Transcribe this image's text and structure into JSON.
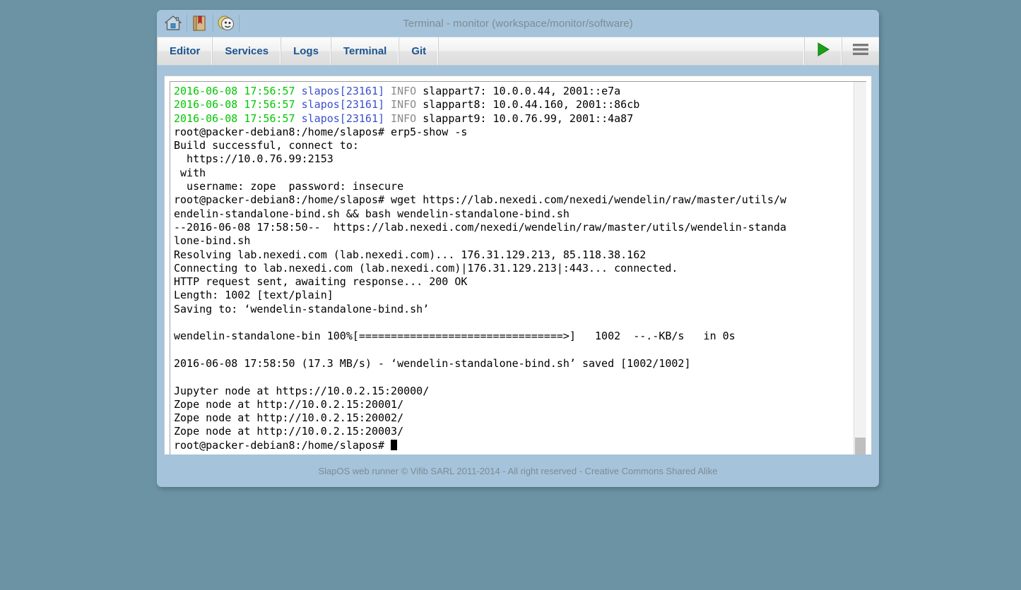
{
  "window": {
    "title": "Terminal - monitor (workspace/monitor/software)",
    "icons": [
      {
        "name": "home-icon",
        "label": "Home"
      },
      {
        "name": "book-icon",
        "label": "Documentation"
      },
      {
        "name": "mask-icon",
        "label": "Theatre"
      }
    ]
  },
  "tabs": [
    {
      "label": "Editor",
      "name": "tab-editor"
    },
    {
      "label": "Services",
      "name": "tab-services"
    },
    {
      "label": "Logs",
      "name": "tab-logs"
    },
    {
      "label": "Terminal",
      "name": "tab-terminal"
    },
    {
      "label": "Git",
      "name": "tab-git"
    }
  ],
  "toolbar": {
    "run_label": "Run",
    "menu_label": "Menu",
    "run_icon": "play-triangle-icon",
    "menu_icon": "hamburger-menu-icon",
    "accent_green": "#1a9c1a"
  },
  "colors": {
    "page_background": "#6b93a4",
    "window_background": "#a5c3da",
    "tab_text": "#1b5490",
    "log_timestamp": "#00c800",
    "log_process": "#3a50cd",
    "log_level": "#8a8a8a"
  },
  "terminal": {
    "lines": [
      {
        "segments": [
          {
            "text": "2016-06-08 17:56:57 ",
            "color": "green"
          },
          {
            "text": "slapos[23161]",
            "color": "blue"
          },
          {
            "text": " INFO",
            "color": "gray"
          },
          {
            "text": " slappart7: 10.0.0.44, 2001::e7a",
            "color": "plain"
          }
        ]
      },
      {
        "segments": [
          {
            "text": "2016-06-08 17:56:57 ",
            "color": "green"
          },
          {
            "text": "slapos[23161]",
            "color": "blue"
          },
          {
            "text": " INFO",
            "color": "gray"
          },
          {
            "text": " slappart8: 10.0.44.160, 2001::86cb",
            "color": "plain"
          }
        ]
      },
      {
        "segments": [
          {
            "text": "2016-06-08 17:56:57 ",
            "color": "green"
          },
          {
            "text": "slapos[23161]",
            "color": "blue"
          },
          {
            "text": " INFO",
            "color": "gray"
          },
          {
            "text": " slappart9: 10.0.76.99, 2001::4a87",
            "color": "plain"
          }
        ]
      },
      {
        "segments": [
          {
            "text": "root@packer-debian8:/home/slapos# erp5-show -s",
            "color": "plain"
          }
        ]
      },
      {
        "segments": [
          {
            "text": "Build successful, connect to:",
            "color": "plain"
          }
        ]
      },
      {
        "segments": [
          {
            "text": "  https://10.0.76.99:2153",
            "color": "plain"
          }
        ]
      },
      {
        "segments": [
          {
            "text": " with",
            "color": "plain"
          }
        ]
      },
      {
        "segments": [
          {
            "text": "  username: zope  password: insecure",
            "color": "plain"
          }
        ]
      },
      {
        "segments": [
          {
            "text": "root@packer-debian8:/home/slapos# wget https://lab.nexedi.com/nexedi/wendelin/raw/master/utils/w",
            "color": "plain"
          }
        ]
      },
      {
        "segments": [
          {
            "text": "endelin-standalone-bind.sh && bash wendelin-standalone-bind.sh",
            "color": "plain"
          }
        ]
      },
      {
        "segments": [
          {
            "text": "--2016-06-08 17:58:50--  https://lab.nexedi.com/nexedi/wendelin/raw/master/utils/wendelin-standa",
            "color": "plain"
          }
        ]
      },
      {
        "segments": [
          {
            "text": "lone-bind.sh",
            "color": "plain"
          }
        ]
      },
      {
        "segments": [
          {
            "text": "Resolving lab.nexedi.com (lab.nexedi.com)... 176.31.129.213, 85.118.38.162",
            "color": "plain"
          }
        ]
      },
      {
        "segments": [
          {
            "text": "Connecting to lab.nexedi.com (lab.nexedi.com)|176.31.129.213|:443... connected.",
            "color": "plain"
          }
        ]
      },
      {
        "segments": [
          {
            "text": "HTTP request sent, awaiting response... 200 OK",
            "color": "plain"
          }
        ]
      },
      {
        "segments": [
          {
            "text": "Length: 1002 [text/plain]",
            "color": "plain"
          }
        ]
      },
      {
        "segments": [
          {
            "text": "Saving to: ‘wendelin-standalone-bind.sh’",
            "color": "plain"
          }
        ]
      },
      {
        "segments": [
          {
            "text": "",
            "color": "plain"
          }
        ]
      },
      {
        "segments": [
          {
            "text": "wendelin-standalone-bin 100%[================================>]   1002  --.-KB/s   in 0s",
            "color": "plain"
          }
        ]
      },
      {
        "segments": [
          {
            "text": "",
            "color": "plain"
          }
        ]
      },
      {
        "segments": [
          {
            "text": "2016-06-08 17:58:50 (17.3 MB/s) - ‘wendelin-standalone-bind.sh’ saved [1002/1002]",
            "color": "plain"
          }
        ]
      },
      {
        "segments": [
          {
            "text": "",
            "color": "plain"
          }
        ]
      },
      {
        "segments": [
          {
            "text": "Jupyter node at https://10.0.2.15:20000/",
            "color": "plain"
          }
        ]
      },
      {
        "segments": [
          {
            "text": "Zope node at http://10.0.2.15:20001/",
            "color": "plain"
          }
        ]
      },
      {
        "segments": [
          {
            "text": "Zope node at http://10.0.2.15:20002/",
            "color": "plain"
          }
        ]
      },
      {
        "segments": [
          {
            "text": "Zope node at http://10.0.2.15:20003/",
            "color": "plain"
          }
        ]
      },
      {
        "segments": [
          {
            "text": "root@packer-debian8:/home/slapos# ",
            "color": "plain"
          }
        ],
        "cursor": true
      }
    ]
  },
  "footer": {
    "text": "SlapOS web runner © Vifib SARL 2011-2014 - All right reserved - Creative Commons Shared Alike"
  }
}
